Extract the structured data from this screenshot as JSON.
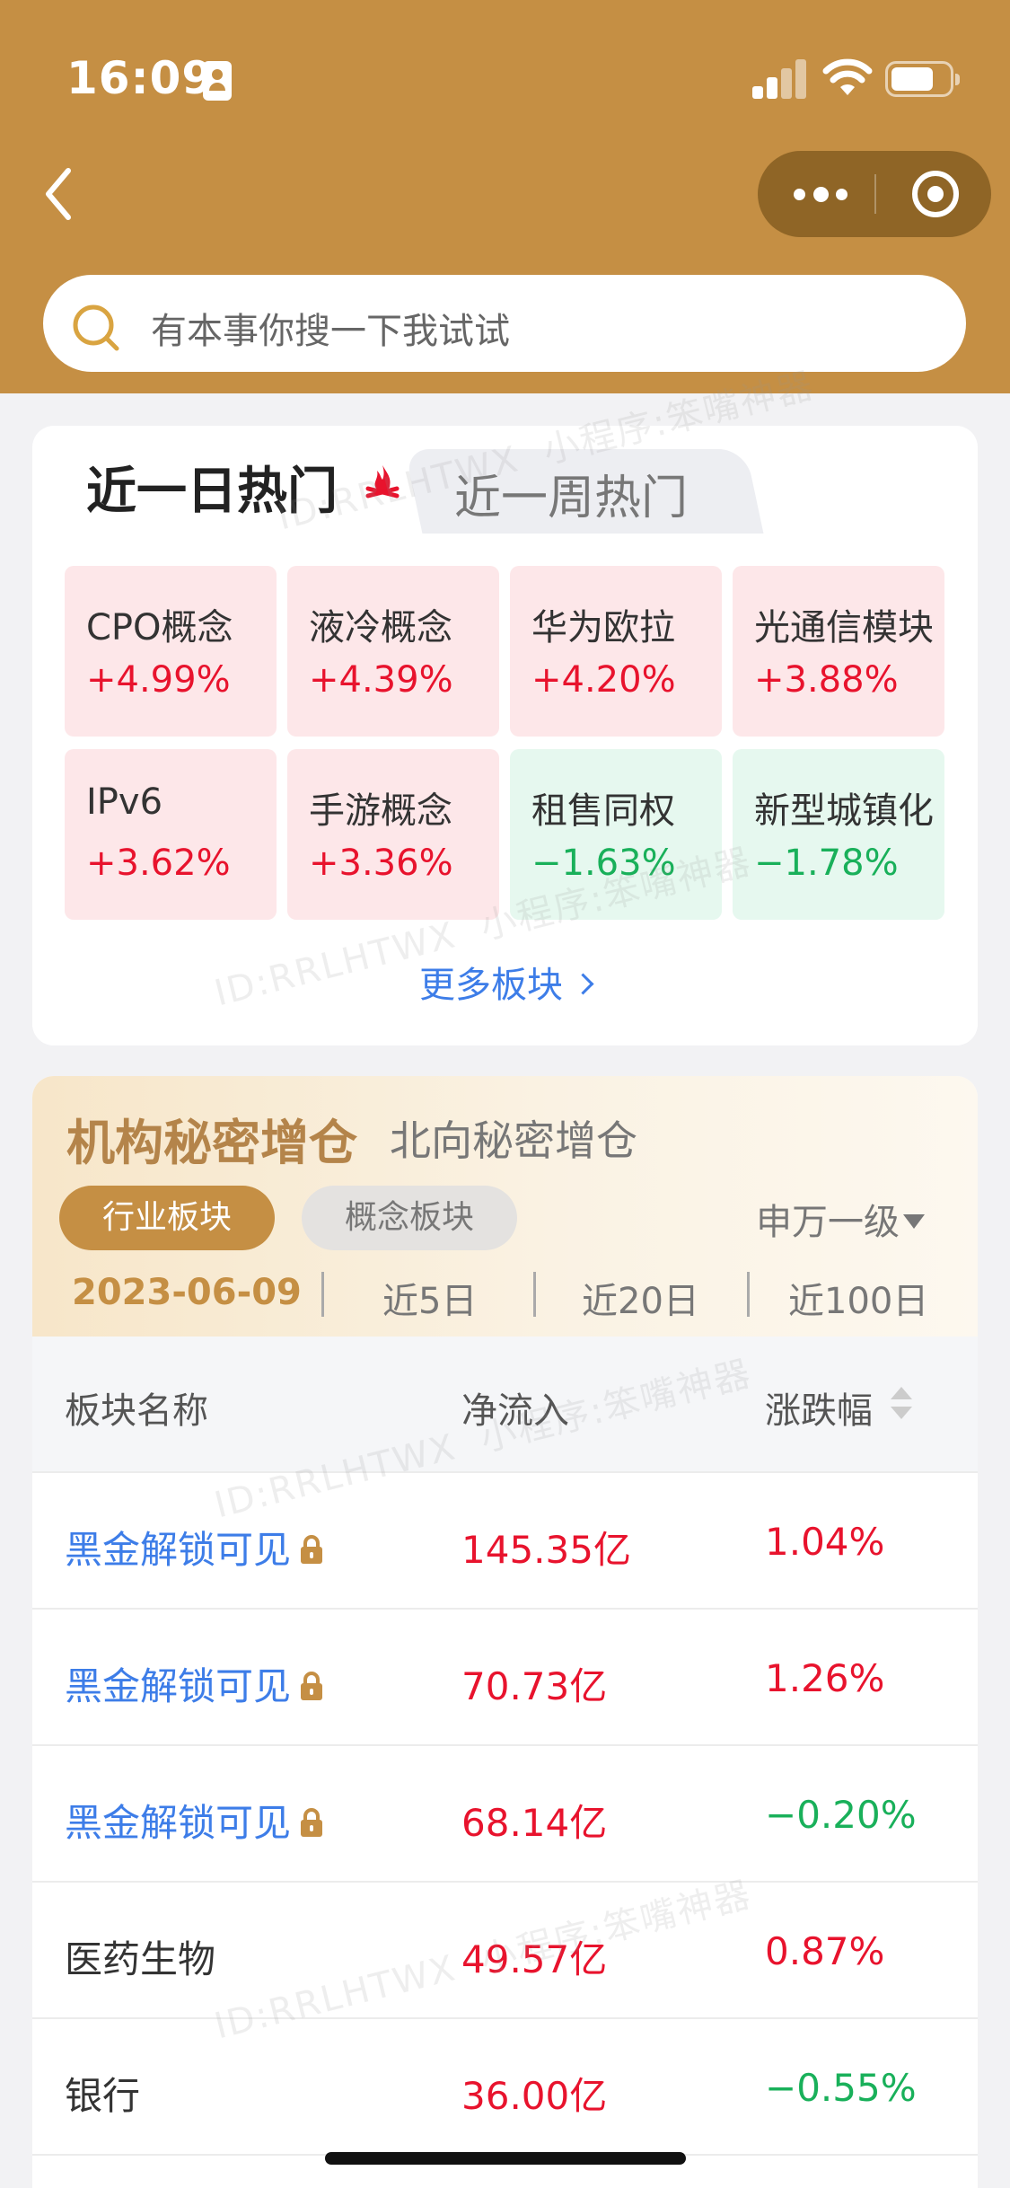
{
  "status_bar": {
    "time": "16:09"
  },
  "search": {
    "placeholder": "有本事你搜一下我试试"
  },
  "hot": {
    "tab_active": "近一日热门",
    "tab_inactive": "近一周热门",
    "tiles": [
      {
        "name": "CPO概念",
        "change": "+4.99%",
        "trend": "up"
      },
      {
        "name": "液冷概念",
        "change": "+4.39%",
        "trend": "up"
      },
      {
        "name": "华为欧拉",
        "change": "+4.20%",
        "trend": "up"
      },
      {
        "name": "光通信模块",
        "change": "+3.88%",
        "trend": "up"
      },
      {
        "name": "IPv6",
        "change": "+3.62%",
        "trend": "up"
      },
      {
        "name": "手游概念",
        "change": "+3.36%",
        "trend": "up"
      },
      {
        "name": "租售同权",
        "change": "−1.63%",
        "trend": "down"
      },
      {
        "name": "新型城镇化",
        "change": "−1.78%",
        "trend": "down"
      }
    ],
    "more_link": "更多板块"
  },
  "institution": {
    "tab_active": "机构秘密增仓",
    "tab_inactive": "北向秘密增仓",
    "pill_active": "行业板块",
    "pill_inactive": "概念板块",
    "level": "申万一级",
    "periods": [
      "2023-06-09",
      "近5日",
      "近20日",
      "近100日"
    ],
    "table": {
      "headers": [
        "板块名称",
        "净流入",
        "涨跌幅"
      ],
      "rows": [
        {
          "name": "黑金解锁可见",
          "flow": "145.35亿",
          "change": "1.04%",
          "trend": "up",
          "locked": true
        },
        {
          "name": "黑金解锁可见",
          "flow": "70.73亿",
          "change": "1.26%",
          "trend": "up",
          "locked": true
        },
        {
          "name": "黑金解锁可见",
          "flow": "68.14亿",
          "change": "−0.20%",
          "trend": "down",
          "locked": true
        },
        {
          "name": "医药生物",
          "flow": "49.57亿",
          "change": "0.87%",
          "trend": "up",
          "locked": false
        },
        {
          "name": "银行",
          "flow": "36.00亿",
          "change": "−0.55%",
          "trend": "down",
          "locked": false
        }
      ]
    }
  },
  "watermark": {
    "line1": "ID:RRLHTWX",
    "line2": "小程序:笨嘴神器"
  },
  "colors": {
    "brand": "#c58f44",
    "up": "#e8132d",
    "down": "#19b05a",
    "link": "#3d7de8"
  },
  "icons": [
    "sim-card-icon",
    "signal-icon",
    "wifi-icon",
    "battery-icon",
    "back-arrow-icon",
    "more-dots-icon",
    "target-icon",
    "search-icon",
    "fire-icon",
    "chevron-right-icon",
    "triangle-down-icon",
    "sort-icon",
    "lock-icon"
  ]
}
